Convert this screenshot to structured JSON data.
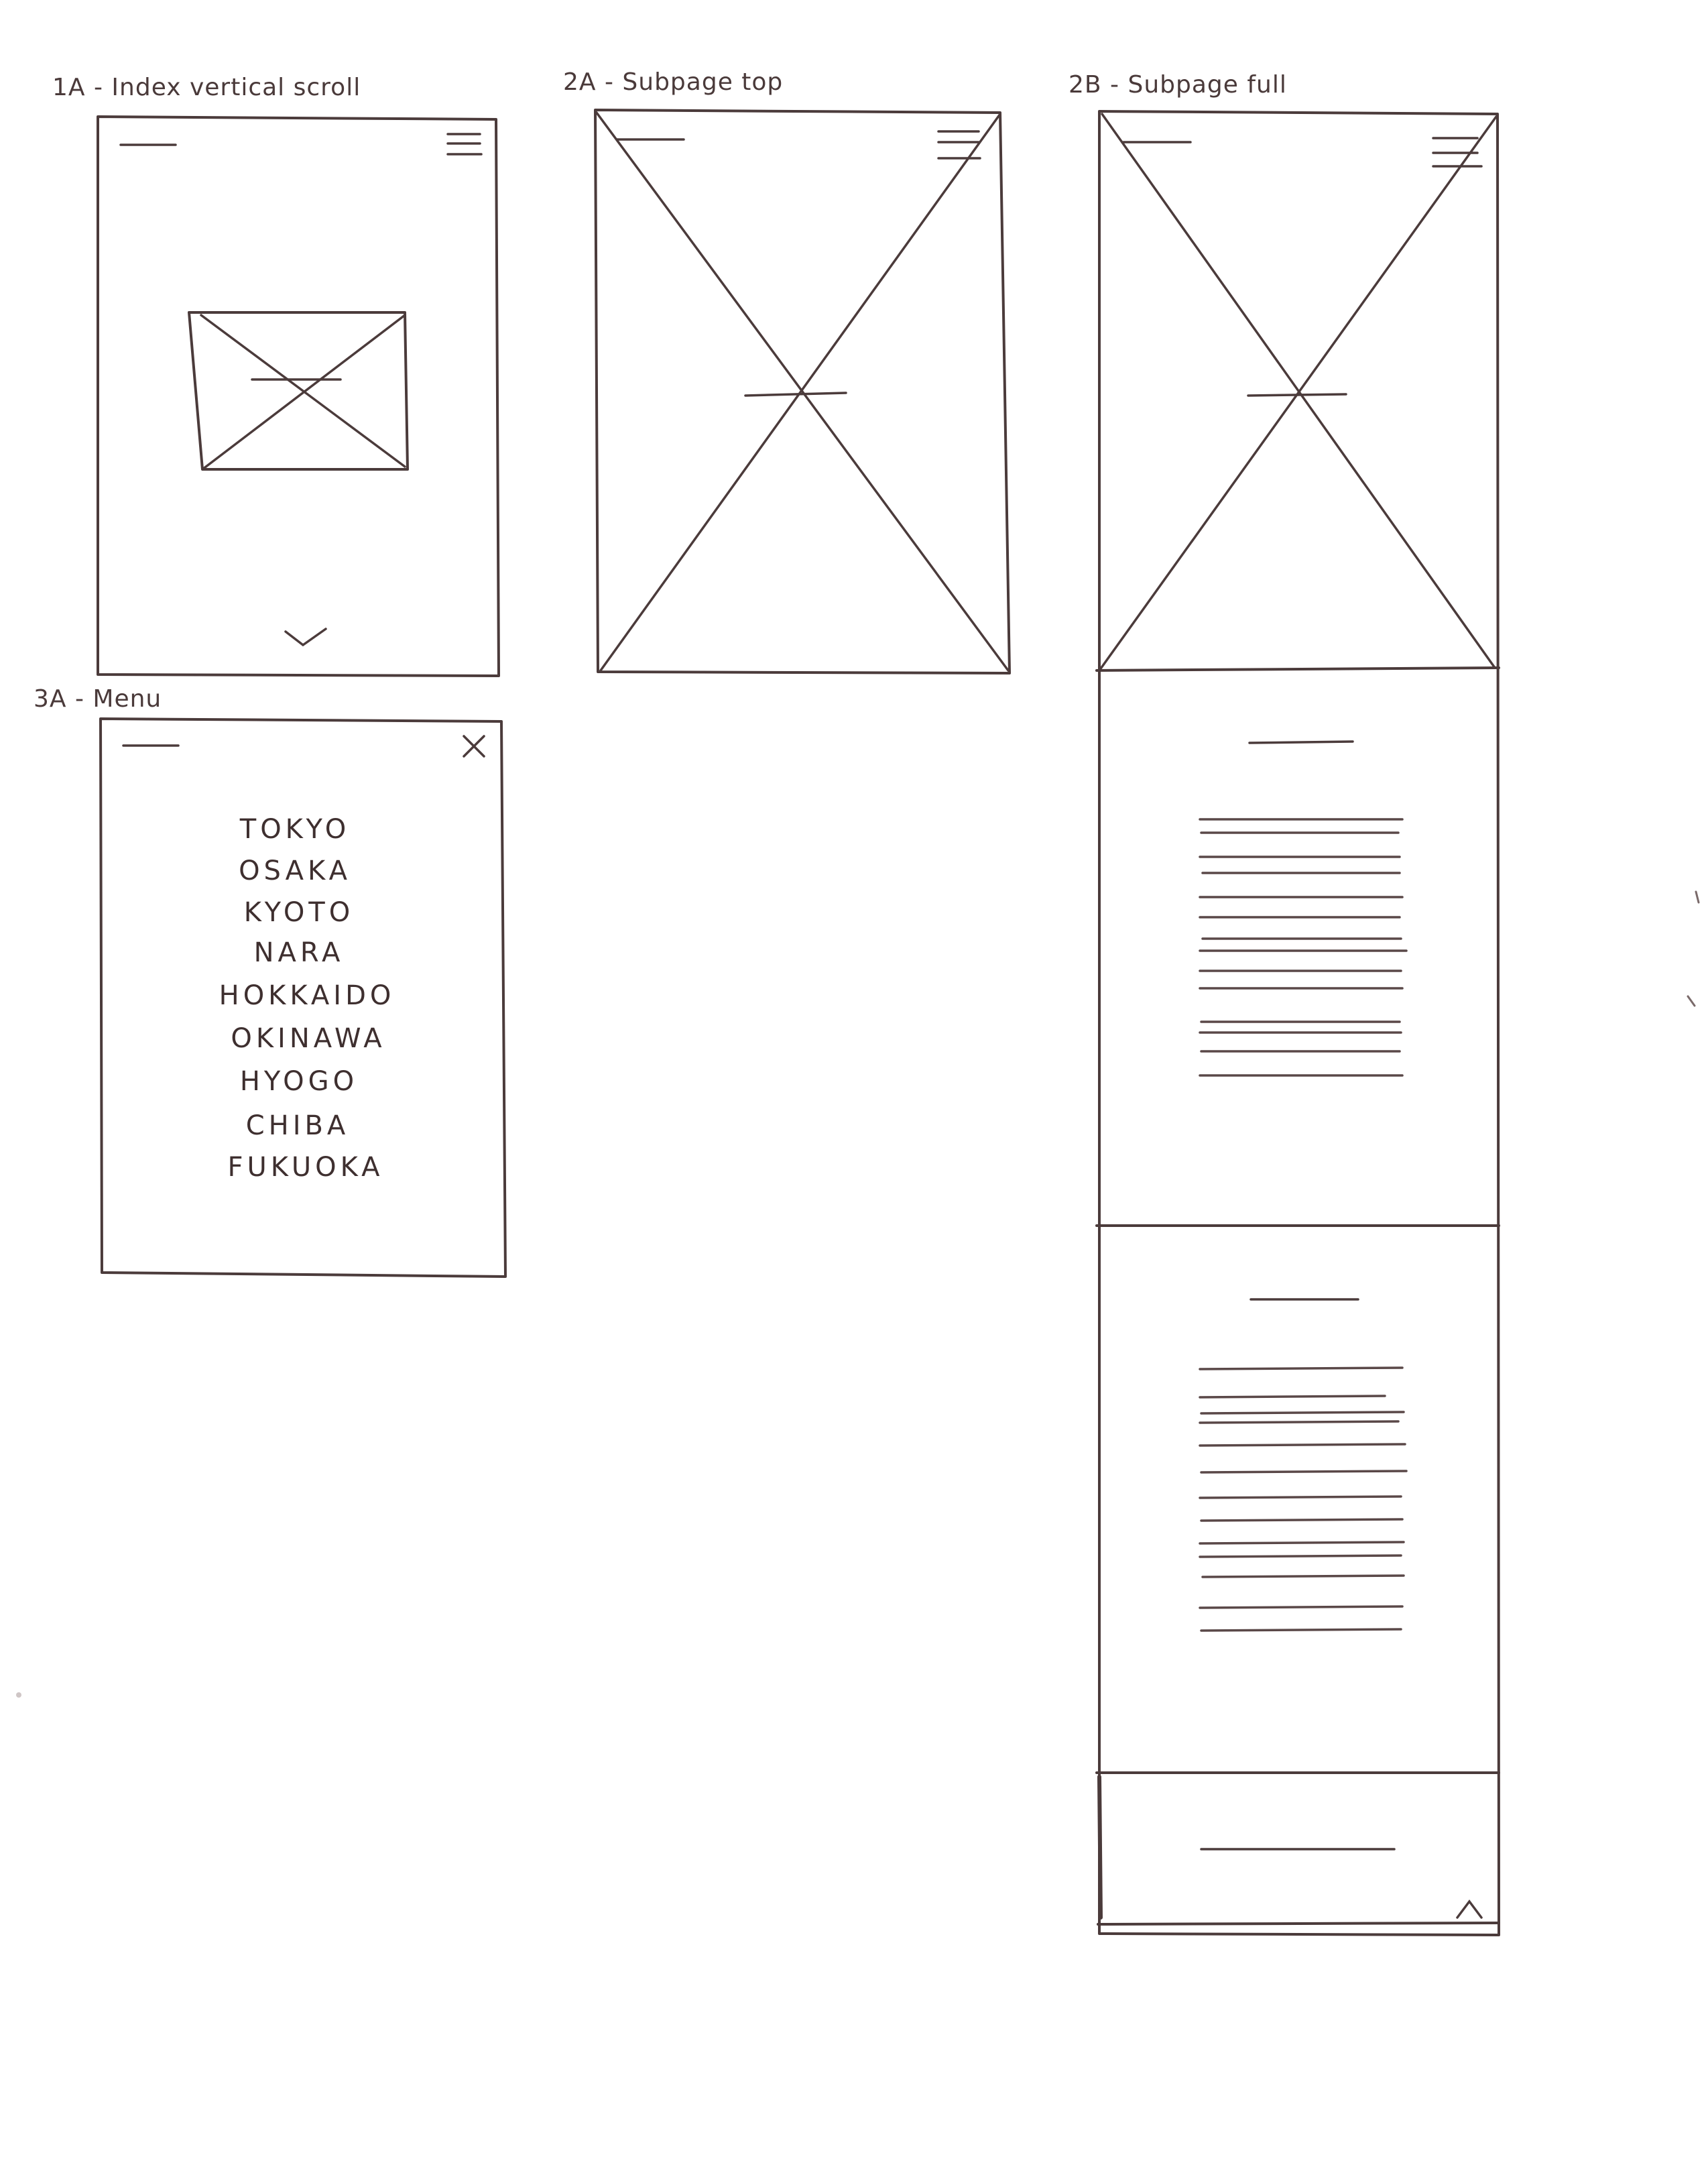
{
  "frames": {
    "index": {
      "label": "1A - Index vertical scroll"
    },
    "subpage_top": {
      "label": "2A - Subpage top"
    },
    "subpage_full": {
      "label": "2B - Subpage full"
    },
    "menu": {
      "label": "3A - Menu",
      "items": [
        "TOKYO",
        "OSAKA",
        "KYOTO",
        "NARA",
        "HOKKAIDO",
        "OKINAWA",
        "HYOGO",
        "CHIBA",
        "FUKUOKA"
      ]
    }
  },
  "icons": {
    "hamburger": "hamburger-menu-icon",
    "close": "close-x-icon",
    "scroll_down": "chevron-down-icon",
    "back_to_top": "chevron-up-icon",
    "image_placeholder": "image-placeholder-icon",
    "logo_placeholder": "logo-line"
  },
  "colors": {
    "ink": "#4b3b3b",
    "paper": "#ffffff"
  }
}
